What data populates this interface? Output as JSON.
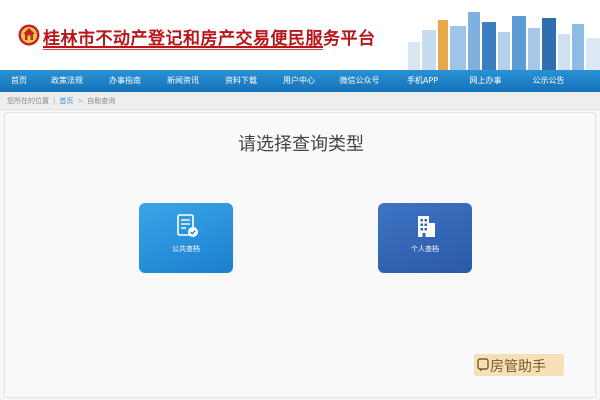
{
  "header": {
    "site_title": "桂林市不动产登记和房产交易便民服务平台",
    "emblem_icon": "emblem-icon",
    "skyline_image": "city-skyline-graphic"
  },
  "nav": {
    "items": [
      {
        "label": "首页"
      },
      {
        "label": "政策法规"
      },
      {
        "label": "办事指南"
      },
      {
        "label": "新闻资讯"
      },
      {
        "label": "资料下载"
      },
      {
        "label": "用户中心"
      },
      {
        "label": "微信公众号"
      },
      {
        "label": "手机APP"
      },
      {
        "label": "网上办事"
      },
      {
        "label": "公示公告"
      }
    ],
    "bg_color": "#1c7cc2"
  },
  "breadcrumb": {
    "prefix": "您所在的位置",
    "home": "首页",
    "current": "自助查询"
  },
  "main": {
    "title": "请选择查询类型",
    "cards": [
      {
        "label": "公共查档",
        "icon": "document-check-icon",
        "color": "#2590da"
      },
      {
        "label": "个人查档",
        "icon": "building-icon",
        "color": "#3366b8"
      }
    ]
  },
  "watermark": {
    "text": "房管助手",
    "icon": "chat-icon"
  }
}
